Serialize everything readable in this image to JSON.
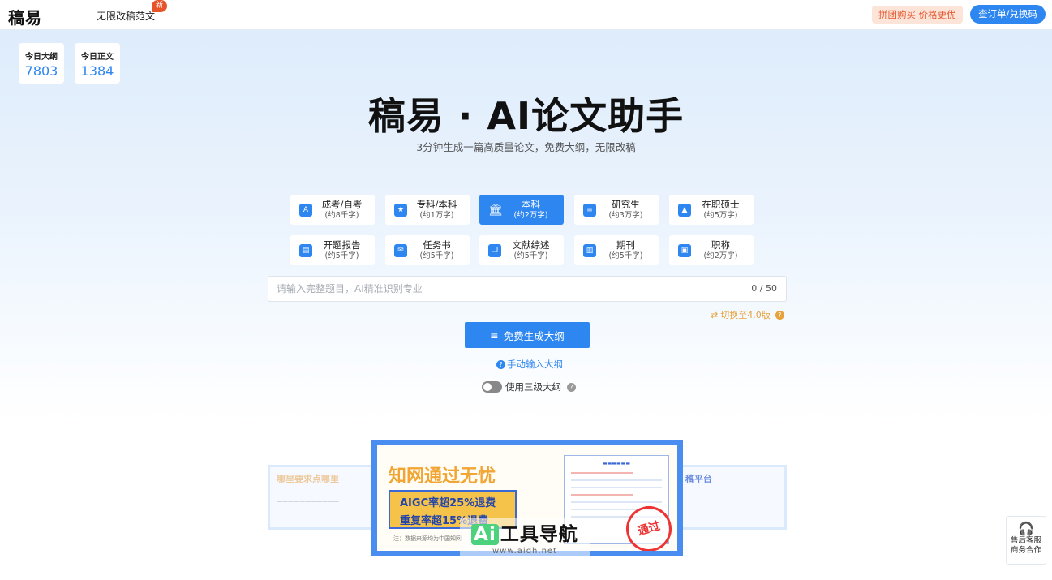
{
  "header": {
    "logo": "稿易",
    "nav_link": "无限改稿范文",
    "new_badge": "新",
    "group_buy": "拼团购买 价格更优",
    "order_button": "查订单/兑换码"
  },
  "stats": [
    {
      "label": "今日大纲",
      "value": "7803"
    },
    {
      "label": "今日正文",
      "value": "1384"
    }
  ],
  "hero": {
    "title": "稿易 · AI论文助手",
    "subtitle": "3分钟生成一篇高质量论文，免费大纲，无限改稿"
  },
  "categories": [
    {
      "name": "成考/自考",
      "sub": "(约8千字)",
      "icon": "exam-icon",
      "active": false
    },
    {
      "name": "专科/本科",
      "sub": "(约1万字)",
      "icon": "star-doc-icon",
      "active": false
    },
    {
      "name": "本科",
      "sub": "(约2万字)",
      "icon": "university-icon",
      "active": true
    },
    {
      "name": "研究生",
      "sub": "(约3万字)",
      "icon": "clipboard-icon",
      "active": false
    },
    {
      "name": "在职硕士",
      "sub": "(约5万字)",
      "icon": "graduate-icon",
      "active": false
    },
    {
      "name": "开题报告",
      "sub": "(约5千字)",
      "icon": "briefcase-doc-icon",
      "active": false
    },
    {
      "name": "任务书",
      "sub": "(约5千字)",
      "icon": "mail-icon",
      "active": false
    },
    {
      "name": "文献综述",
      "sub": "(约5千字)",
      "icon": "documents-icon",
      "active": false
    },
    {
      "name": "期刊",
      "sub": "(约5千字)",
      "icon": "book-icon",
      "active": false
    },
    {
      "name": "职称",
      "sub": "(约2万字)",
      "icon": "suitcase-icon",
      "active": false
    }
  ],
  "input": {
    "placeholder": "请输入完整题目，AI精准识别专业",
    "value": "",
    "counter": "0 / 50"
  },
  "switch_version": "切换至4.0版",
  "generate_button": "免费生成大纲",
  "manual_outline": "手动输入大纲",
  "three_level_toggle": "使用三级大纲",
  "banner": {
    "title": "知网通过无忧",
    "line1": "AIGC率超25%退费",
    "line2": "重复率超15%退费",
    "note": "注：数据来源均为中国知网",
    "stamp": "通过",
    "left_card_title": "哪里要求点哪里",
    "right_card_title": "稿平台"
  },
  "watermark": {
    "main": "工具导航",
    "ai": "Ai",
    "url": "www.aidh.net"
  },
  "service": {
    "line1": "售后客服",
    "line2": "商务合作"
  },
  "colors": {
    "accent": "#2e86f0",
    "warning": "#e6a23c",
    "promo": "#e4572e"
  }
}
